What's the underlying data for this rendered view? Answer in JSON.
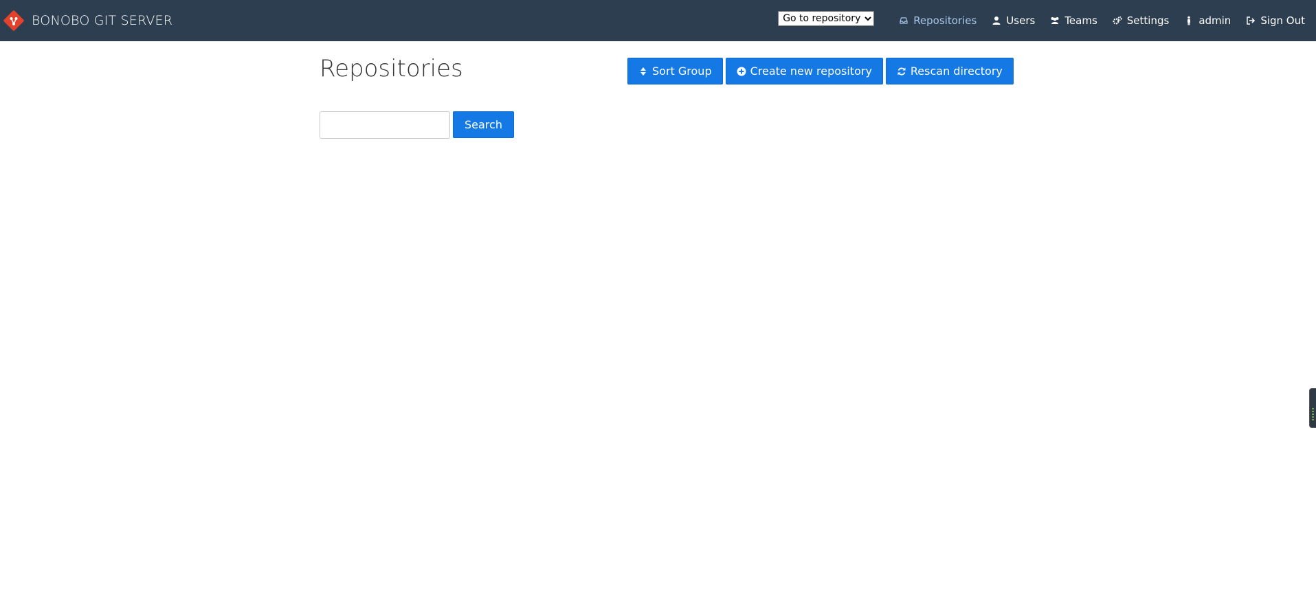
{
  "navbar": {
    "brand": "BONOBO GIT SERVER",
    "repo_select": {
      "selected": "Go to repository"
    },
    "links": [
      {
        "label": "Repositories",
        "icon": "repository-icon",
        "active": true
      },
      {
        "label": "Users",
        "icon": "user-icon",
        "active": false
      },
      {
        "label": "Teams",
        "icon": "team-icon",
        "active": false
      },
      {
        "label": "Settings",
        "icon": "gears-icon",
        "active": false
      },
      {
        "label": "admin",
        "icon": "person-icon",
        "active": false
      },
      {
        "label": "Sign Out",
        "icon": "sign-out-icon",
        "active": false
      }
    ]
  },
  "main": {
    "title": "Repositories",
    "actions": {
      "sort_group": "Sort Group",
      "create_repo": "Create new repository",
      "rescan": "Rescan directory"
    },
    "search": {
      "value": "",
      "button": "Search"
    }
  },
  "colors": {
    "navbar_bg": "#2c3e50",
    "primary": "#1479e4",
    "active_link": "#a9c6e8",
    "logo_red": "#e2412c"
  }
}
